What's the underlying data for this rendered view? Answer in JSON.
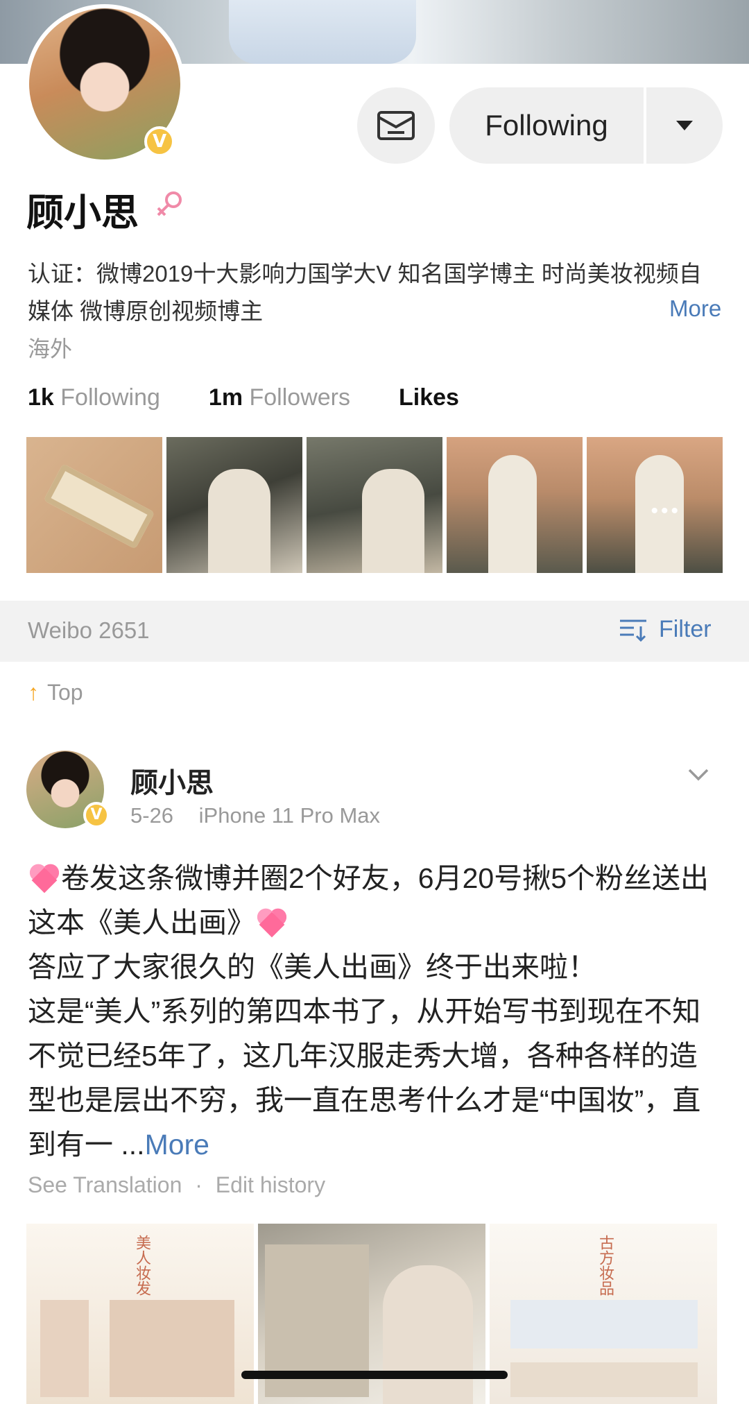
{
  "profile": {
    "name": "顾小思",
    "verified_badge": "V",
    "gender_icon": "female-icon",
    "certification": "认证：微博2019十大影响力国学大V 知名国学博主 时尚美妆视频自媒体 微博原创视频博主",
    "more_label": "More",
    "location": "海外"
  },
  "actions": {
    "message_icon": "message-icon",
    "follow_label": "Following",
    "dropdown_icon": "caret-down-icon"
  },
  "stats": {
    "following_value": "1k",
    "following_label": "Following",
    "followers_value": "1m",
    "followers_label": "Followers",
    "likes_label": "Likes"
  },
  "feed_bar": {
    "weibo_label": "Weibo 2651",
    "filter_label": "Filter"
  },
  "pinned": {
    "label": "Top"
  },
  "post": {
    "author": "顾小思",
    "date": "5-26",
    "device": "iPhone 11 Pro Max",
    "text_line1": "卷发这条微博并圈2个好友，6月20号揪5个粉丝送出这本《美人出画》",
    "text_line2": "答应了大家很久的《美人出画》终于出来啦！",
    "text_line3": "这是“美人”系列的第四本书了，从开始写书到现在不知不觉已经5年了，这几年汉服走秀大增，各种各样的造型也是层出不穷，我一直在思考什么才是“中国妆”，直到有一 ...",
    "more_label": "More",
    "see_translation": "See Translation",
    "separator": "·",
    "edit_history": "Edit history",
    "image1_title": "美人妆发",
    "image3_title": "古方妆品"
  },
  "colors": {
    "link": "#4a7bb8",
    "badge": "#f6c343",
    "top_arrow": "#f5a623",
    "gender": "#f08aa8"
  }
}
